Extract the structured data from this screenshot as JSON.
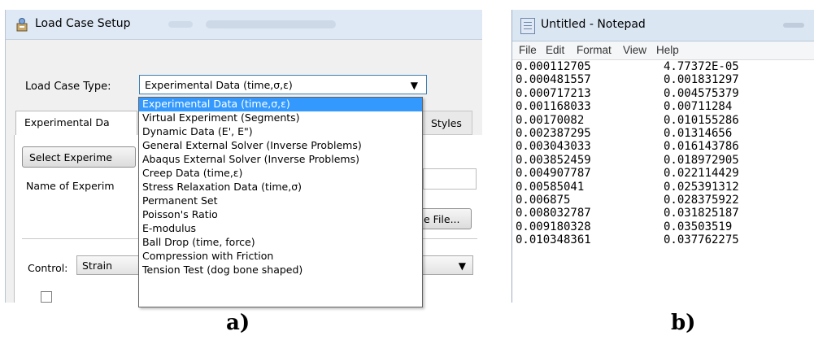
{
  "panel_a": {
    "window_title": "Load Case Setup",
    "load_case_type_label": "Load Case Type:",
    "load_case_type_value": "Experimental Data (time,σ,ε)",
    "tabs": {
      "experimental": "Experimental Da",
      "styles": "Styles"
    },
    "select_button": "Select Experime",
    "name_label": "Name of Experim",
    "file_button": "e File...",
    "control_label": "Control:",
    "control_value": "Strain",
    "dropdown_options": [
      "Experimental Data (time,σ,ε)",
      "Virtual Experiment (Segments)",
      "Dynamic Data (E', E\")",
      "General External Solver (Inverse Problems)",
      "Abaqus External Solver (Inverse Problems)",
      "Creep Data (time,ε)",
      "Stress Relaxation Data (time,σ)",
      "Permanent Set",
      "Poisson's Ratio",
      "E-modulus",
      "Ball Drop (time, force)",
      "Compression with Friction",
      "Tension Test (dog bone shaped)"
    ],
    "selected_index": 0,
    "caption": "a)"
  },
  "panel_b": {
    "window_title": "Untitled - Notepad",
    "menu": [
      "File",
      "Edit",
      "Format",
      "View",
      "Help"
    ],
    "rows": [
      [
        "0.000112705",
        "4.77372E-05"
      ],
      [
        "0.000481557",
        "0.001831297"
      ],
      [
        "0.000717213",
        "0.004575379"
      ],
      [
        "0.001168033",
        "0.00711284"
      ],
      [
        "0.00170082",
        "0.010155286"
      ],
      [
        "0.002387295",
        "0.01314656"
      ],
      [
        "0.003043033",
        "0.016143786"
      ],
      [
        "0.003852459",
        "0.018972905"
      ],
      [
        "0.004907787",
        "0.022114429"
      ],
      [
        "0.00585041",
        "0.025391312"
      ],
      [
        "0.006875",
        "0.028375922"
      ],
      [
        "0.008032787",
        "0.031825187"
      ],
      [
        "0.009180328",
        "0.03503519"
      ],
      [
        "0.010348361",
        "0.037762275"
      ]
    ],
    "caption": "b)"
  },
  "colors": {
    "selection": "#3399ff",
    "title_bar": "#dfe9f5",
    "dialog_bg": "#f0f0f0"
  }
}
